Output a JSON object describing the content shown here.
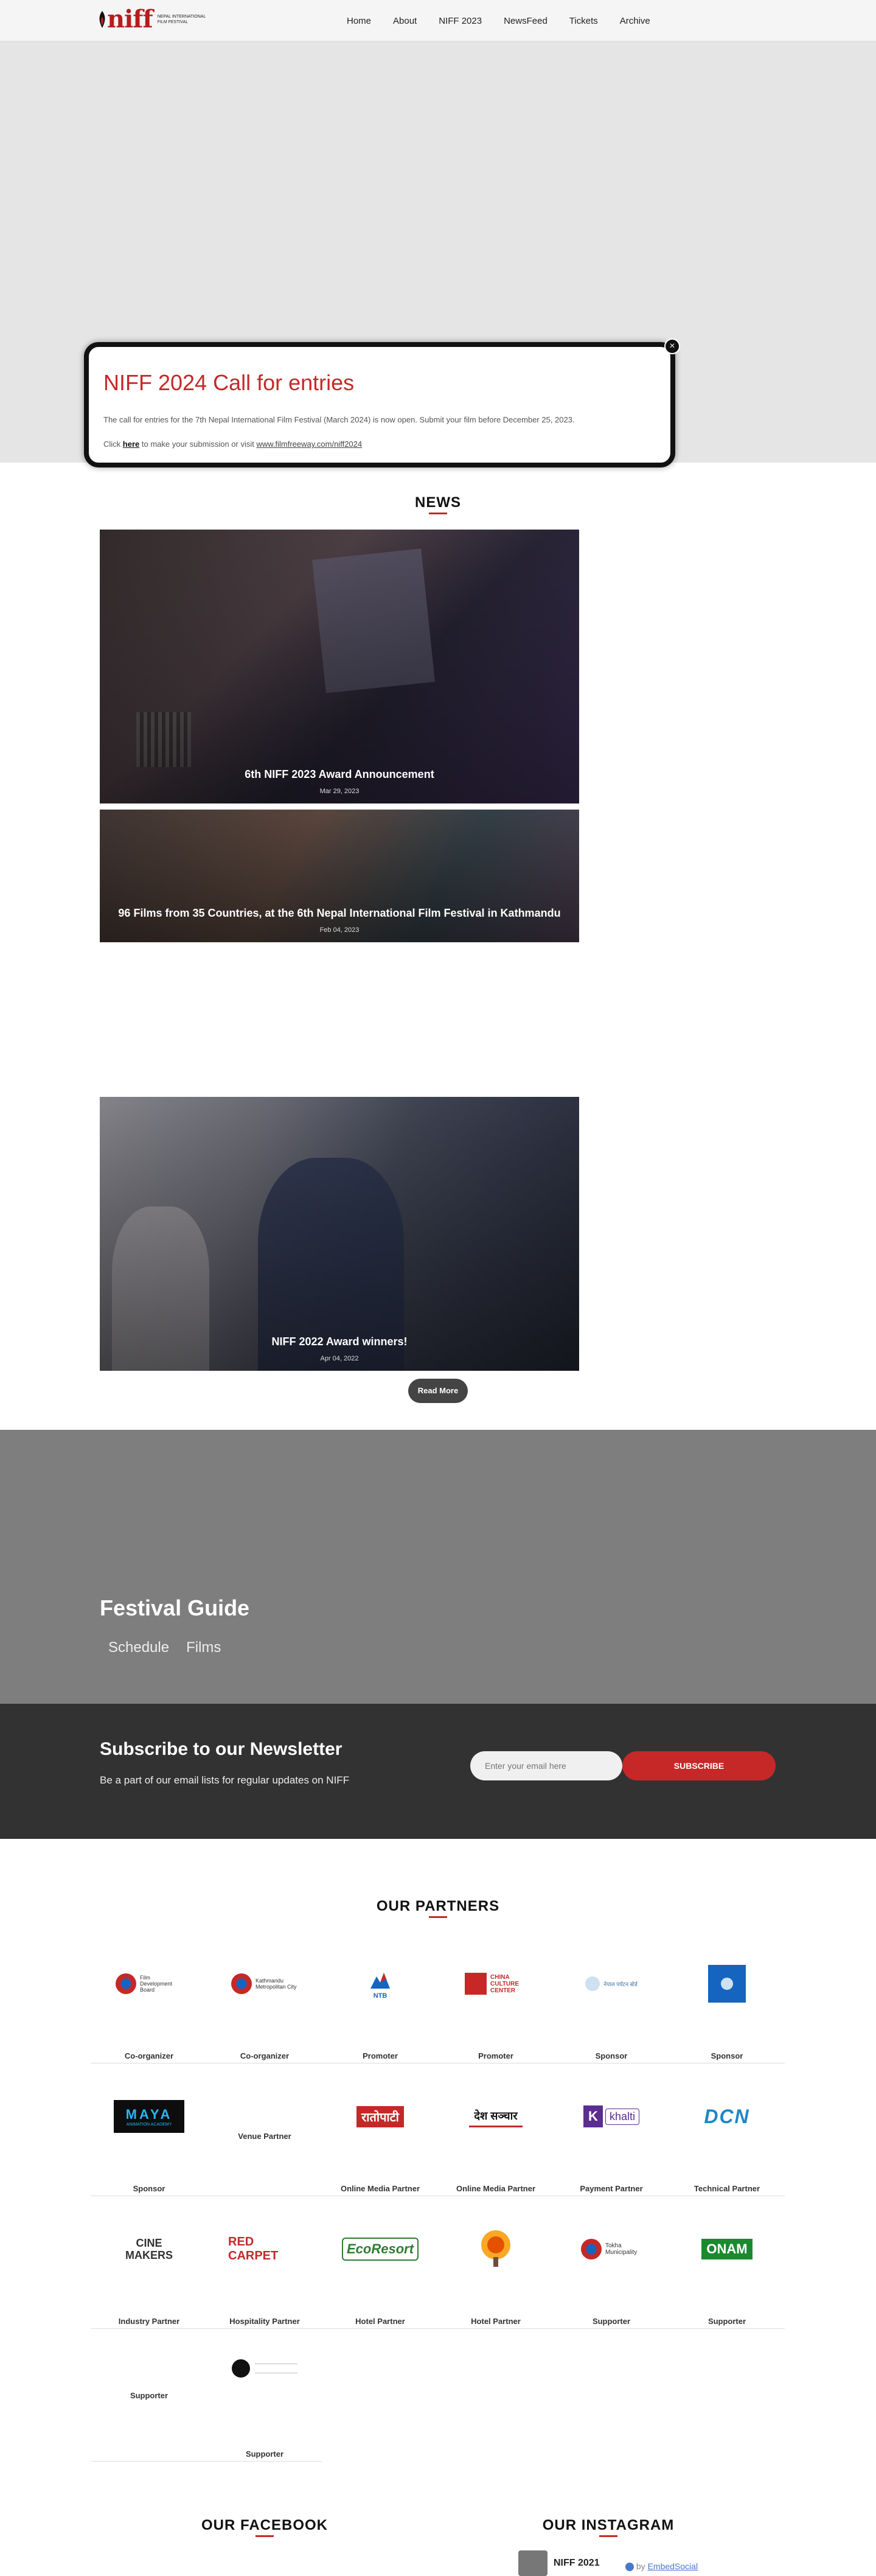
{
  "header": {
    "logo_text": "niff",
    "logo_sub": "NEPAL INTERNATIONAL FILM FESTIVAL",
    "nav": [
      "Home",
      "About",
      "NIFF 2023",
      "NewsFeed",
      "Tickets",
      "Archive"
    ]
  },
  "popup": {
    "close": "×",
    "title": "NIFF 2024 Call for entries",
    "text": "The call for entries for the 7th Nepal International Film Festival (March 2024) is now open. Submit your film before December 25, 2023.",
    "click": "Click",
    "here": "here",
    "to_make": "to make your submission or visit",
    "link": "www.filmfreeway.com/niff2024"
  },
  "news": {
    "title": "NEWS",
    "items": [
      {
        "title": "6th NIFF 2023 Award Announcement",
        "date": "Mar 29, 2023"
      },
      {
        "title": "96 Films from 35 Countries, at the 6th Nepal International Film Festival in Kathmandu",
        "date": "Feb 04, 2023"
      },
      {
        "title": "NIFF 2022 Award winners!",
        "date": "Apr 04, 2022"
      }
    ],
    "read_more": "Read More"
  },
  "guide": {
    "title": "Festival Guide",
    "links": [
      "Schedule",
      "Films"
    ]
  },
  "newsletter": {
    "title": "Subscribe to our Newsletter",
    "text": "Be a part of our email lists for regular updates on NIFF",
    "placeholder": "Enter your email here",
    "button": "SUBSCRIBE"
  },
  "partners": {
    "title": "OUR PARTNERS",
    "rows": [
      [
        {
          "logo": "Film Development Board",
          "label": "Co-organizer"
        },
        {
          "logo": "Kathmandu Metropolitan City",
          "label": "Co-organizer"
        },
        {
          "logo": "NTB",
          "label": "Promoter"
        },
        {
          "logo": "CHINA CULTURE CENTER",
          "label": "Promoter"
        },
        {
          "logo": "नेपाल पर्यटन बोर्ड",
          "label": "Sponsor"
        },
        {
          "logo": "",
          "label": "Sponsor"
        }
      ],
      [
        {
          "logo": "MAYA",
          "logo_sub": "ANIMATION ACADEMY",
          "label": "Sponsor"
        },
        {
          "logo": "",
          "label": "Venue Partner"
        },
        {
          "logo": "रातोपाटी",
          "label": "Online Media Partner"
        },
        {
          "logo": "देश सञ्चार",
          "label": "Online Media Partner"
        },
        {
          "logo": "khalti",
          "label": "Payment Partner"
        },
        {
          "logo": "DCN",
          "label": "Technical Partner"
        }
      ],
      [
        {
          "logo": "CINE MAKERS",
          "label": "Industry Partner"
        },
        {
          "logo": "RED CARPET",
          "label": "Hospitality Partner"
        },
        {
          "logo": "EcoResort",
          "label": "Hotel Partner"
        },
        {
          "logo": "",
          "label": "Hotel Partner"
        },
        {
          "logo": "Tokha Municipality",
          "label": "Supporter"
        },
        {
          "logo": "ONAM",
          "label": "Supporter"
        }
      ],
      [
        {
          "logo": "",
          "label": "Supporter"
        },
        {
          "logo": "",
          "label": "Supporter"
        }
      ]
    ]
  },
  "social": {
    "facebook_title": "OUR FACEBOOK",
    "instagram_title": "OUR INSTAGRAM",
    "insta_name": "NIFF 2021",
    "embed_by": "by",
    "embed_link": "EmbedSocial"
  },
  "colors": {
    "accent": "#c62828",
    "dark": "#323232",
    "guide_bg": "#7e7e7e"
  }
}
